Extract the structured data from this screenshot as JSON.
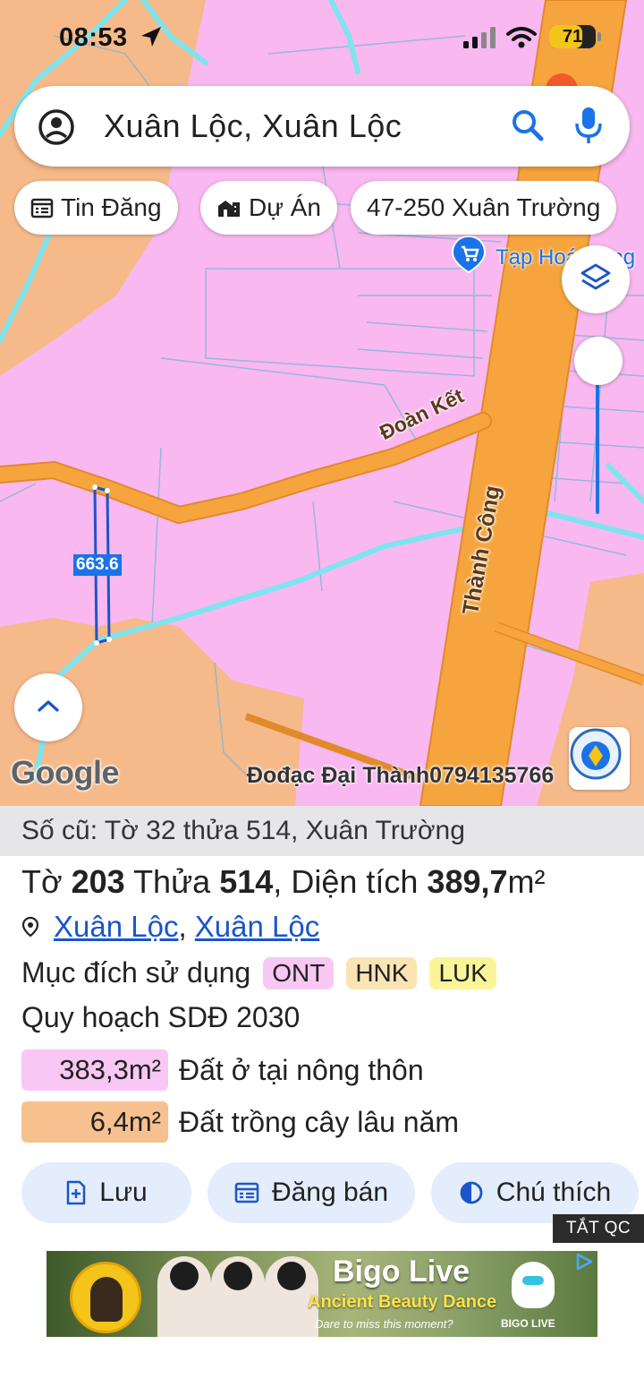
{
  "status_bar": {
    "time": "08:53",
    "battery": "71",
    "icons": [
      "location-arrow-icon",
      "signal-icon",
      "wifi-icon",
      "battery-icon"
    ]
  },
  "search": {
    "query": "Xuân Lộc, Xuân Lộc",
    "icons": [
      "account-icon",
      "search-icon",
      "mic-icon"
    ]
  },
  "chips": [
    {
      "label": "Tin Đăng",
      "icon": "calendar-list-icon"
    },
    {
      "label": "Dự Án",
      "icon": "buildings-icon"
    },
    {
      "label": "47-250 Xuân Trường"
    }
  ],
  "map": {
    "shop_label": "Tạp Hoá Hồng",
    "road_labels": {
      "doan_ket": "Đoàn Kết",
      "thanh_cong": "Thành Công"
    },
    "parcel_label": "663.6",
    "google_logo": "Google",
    "watermark": "Đođạc Đại Thành0794135766",
    "colors": {
      "residential": "#f9b8f0",
      "perennial": "#f6b98a",
      "road": "#f6a53e",
      "water": "#7ee4ee"
    }
  },
  "sheet": {
    "old_number": "Số cũ: Tờ 32 thửa 514, Xuân Trường",
    "title": {
      "to_label": "Tờ",
      "to_value": "203",
      "thua_label": "Thửa",
      "thua_value": "514",
      "area_label": "Diện tích",
      "area_value": "389,7",
      "area_unit": "m²"
    },
    "location": {
      "part1": "Xuân Lộc",
      "separator": ", ",
      "part2": "Xuân Lộc"
    },
    "purpose": {
      "label": "Mục đích sử dụng",
      "tags": [
        {
          "code": "ONT",
          "color": "#f9c7f3"
        },
        {
          "code": "HNK",
          "color": "#fbe4b3"
        },
        {
          "code": "LUK",
          "color": "#fbf59a"
        }
      ]
    },
    "plan_title": "Quy hoạch SDĐ 2030",
    "areas": [
      {
        "value": "383,3m²",
        "label": "Đất ở tại nông thôn",
        "color": "#f9c7f3"
      },
      {
        "value": "6,4m²",
        "label": "Đất trồng cây lâu năm",
        "color": "#f7c08f"
      }
    ],
    "actions": [
      {
        "label": "Lưu",
        "icon": "save-plus-icon"
      },
      {
        "label": "Đăng bán",
        "icon": "listing-icon"
      },
      {
        "label": "Chú thích",
        "icon": "contrast-icon"
      }
    ],
    "ads_off": "TẮT QC"
  },
  "ad": {
    "title": "Bigo Live",
    "subtitle": "Ancient Beauty Dance",
    "tagline": "Dare to miss this moment?",
    "brand": "BIGO LIVE"
  }
}
